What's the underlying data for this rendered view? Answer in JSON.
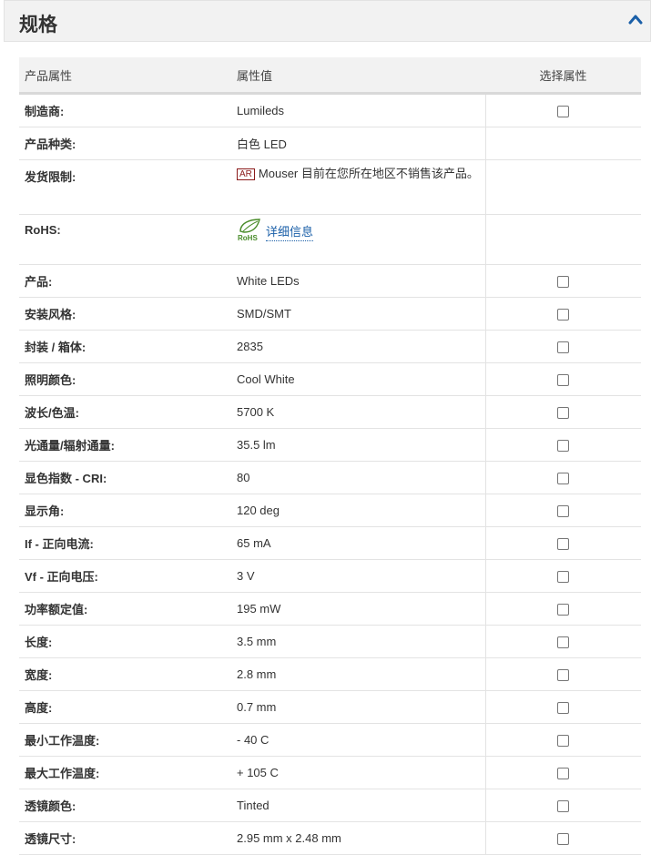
{
  "panel": {
    "title": "规格",
    "collapse_icon": "chevron-up-icon",
    "accent": "#1a5fa8"
  },
  "table": {
    "headers": {
      "name": "产品属性",
      "value": "属性值",
      "select": "选择属性"
    },
    "rows": [
      {
        "name": "制造商:",
        "value": "Lumileds",
        "checkbox": true
      },
      {
        "name": "产品种类:",
        "value": "白色 LED",
        "checkbox": false
      },
      {
        "name": "发货限制:",
        "badge": "AR",
        "value": "Mouser 目前在您所在地区不销售该产品。",
        "checkbox": false
      },
      {
        "name": "RoHS:",
        "icon": "rohs-leaf-icon",
        "icon_text": "RoHS",
        "link": "详细信息",
        "checkbox": false
      },
      {
        "name": "产品:",
        "value": "White LEDs",
        "checkbox": true
      },
      {
        "name": "安装风格:",
        "value": "SMD/SMT",
        "checkbox": true
      },
      {
        "name": "封装 / 箱体:",
        "value": "2835",
        "checkbox": true
      },
      {
        "name": "照明颜色:",
        "value": "Cool White",
        "checkbox": true
      },
      {
        "name": "波长/色温:",
        "value": "5700 K",
        "checkbox": true
      },
      {
        "name": "光通量/辐射通量:",
        "value": "35.5 lm",
        "checkbox": true
      },
      {
        "name": "显色指数 - CRI:",
        "value": "80",
        "checkbox": true
      },
      {
        "name": "显示角:",
        "value": "120 deg",
        "checkbox": true
      },
      {
        "name": "If - 正向电流:",
        "value": "65 mA",
        "checkbox": true
      },
      {
        "name": "Vf - 正向电压:",
        "value": "3 V",
        "checkbox": true
      },
      {
        "name": "功率额定值:",
        "value": "195 mW",
        "checkbox": true
      },
      {
        "name": "长度:",
        "value": "3.5 mm",
        "checkbox": true
      },
      {
        "name": "宽度:",
        "value": "2.8 mm",
        "checkbox": true
      },
      {
        "name": "高度:",
        "value": "0.7 mm",
        "checkbox": true
      },
      {
        "name": "最小工作温度:",
        "value": "- 40 C",
        "checkbox": true
      },
      {
        "name": "最大工作温度:",
        "value": "+ 105 C",
        "checkbox": true
      },
      {
        "name": "透镜颜色:",
        "value": "Tinted",
        "checkbox": true
      },
      {
        "name": "透镜尺寸:",
        "value": "2.95 mm x 2.48 mm",
        "checkbox": true
      }
    ]
  }
}
